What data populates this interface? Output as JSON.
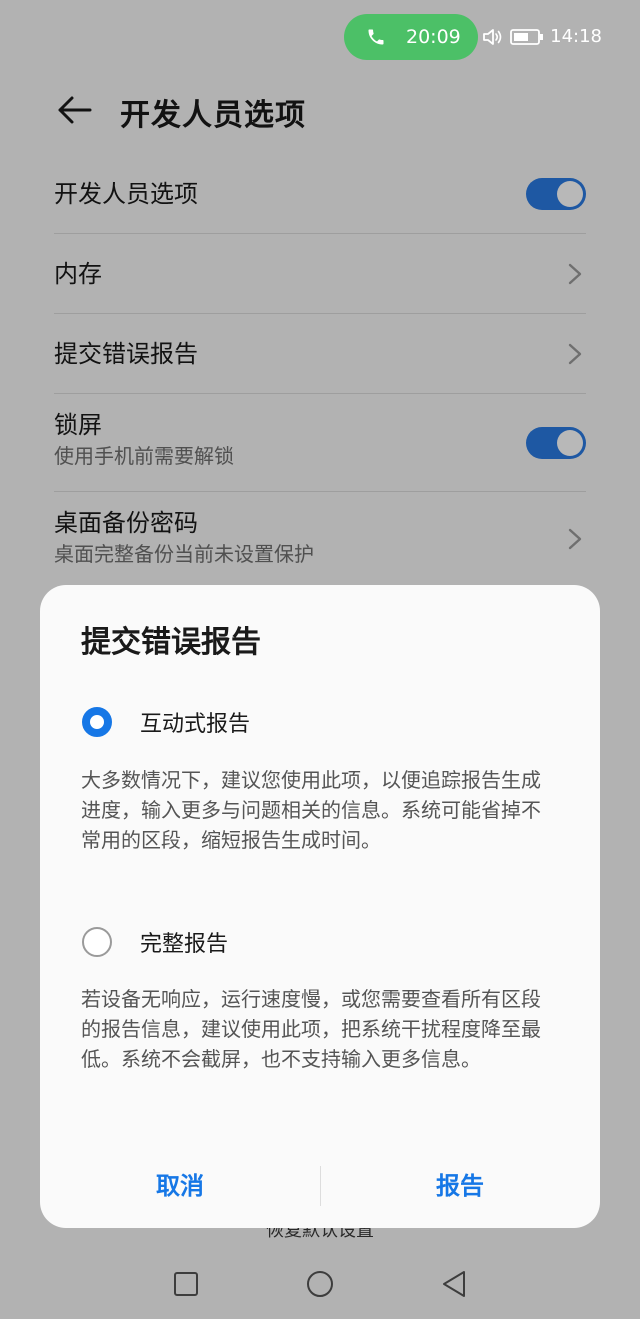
{
  "status_bar": {
    "call_timer": "20:09",
    "clock": "14:18",
    "icons": [
      "phone-icon",
      "speaker-icon",
      "battery-icon"
    ]
  },
  "header": {
    "title": "开发人员选项"
  },
  "settings": {
    "items": [
      {
        "title": "开发人员选项",
        "control": "toggle",
        "on": true
      },
      {
        "title": "内存",
        "control": "chevron"
      },
      {
        "title": "提交错误报告",
        "control": "chevron"
      },
      {
        "title": "锁屏",
        "subtitle": "使用手机前需要解锁",
        "control": "toggle",
        "on": true
      },
      {
        "title": "桌面备份密码",
        "subtitle": "桌面完整备份当前未设置保护",
        "control": "chevron"
      }
    ],
    "restore_defaults": "恢复默认设置"
  },
  "dialog": {
    "title": "提交错误报告",
    "options": [
      {
        "label": "互动式报告",
        "selected": true,
        "description": "大多数情况下，建议您使用此项，以便追踪报告生成进度，输入更多与问题相关的信息。系统可能省掉不常用的区段，缩短报告生成时间。"
      },
      {
        "label": "完整报告",
        "selected": false,
        "description": "若设备无响应，运行速度慢，或您需要查看所有区段的报告信息，建议使用此项，把系统干扰程度降至最低。系统不会截屏，也不支持输入更多信息。"
      }
    ],
    "cancel_label": "取消",
    "confirm_label": "报告"
  },
  "colors": {
    "accent": "#1677e6",
    "toggle_on": "#2a7ae2",
    "call_pill": "#4cc067"
  }
}
